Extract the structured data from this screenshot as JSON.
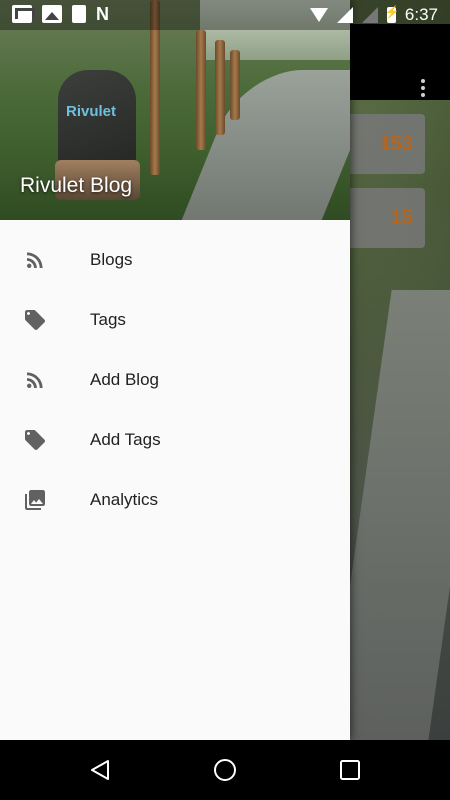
{
  "status_bar": {
    "time": "6:37",
    "left_icons": [
      "gmail-icon",
      "photos-icon",
      "phone-icon",
      "n-icon"
    ],
    "right_icons": [
      "wifi-icon",
      "signal-icon",
      "signal-empty-icon",
      "battery-charging-icon"
    ]
  },
  "background": {
    "counts": [
      "153",
      "15"
    ],
    "count_color": "#b5651d"
  },
  "drawer": {
    "title": "Rivulet Blog",
    "logo_text": "Rivulet",
    "items": [
      {
        "label": "Blogs",
        "icon": "rss-icon"
      },
      {
        "label": "Tags",
        "icon": "tag-icon"
      },
      {
        "label": "Add Blog",
        "icon": "rss-icon"
      },
      {
        "label": "Add Tags",
        "icon": "tag-icon"
      },
      {
        "label": "Analytics",
        "icon": "photo-library-icon"
      }
    ],
    "icon_color": "#616161"
  },
  "nav_bar": {
    "buttons": [
      "back-icon",
      "home-icon",
      "recents-icon"
    ]
  }
}
